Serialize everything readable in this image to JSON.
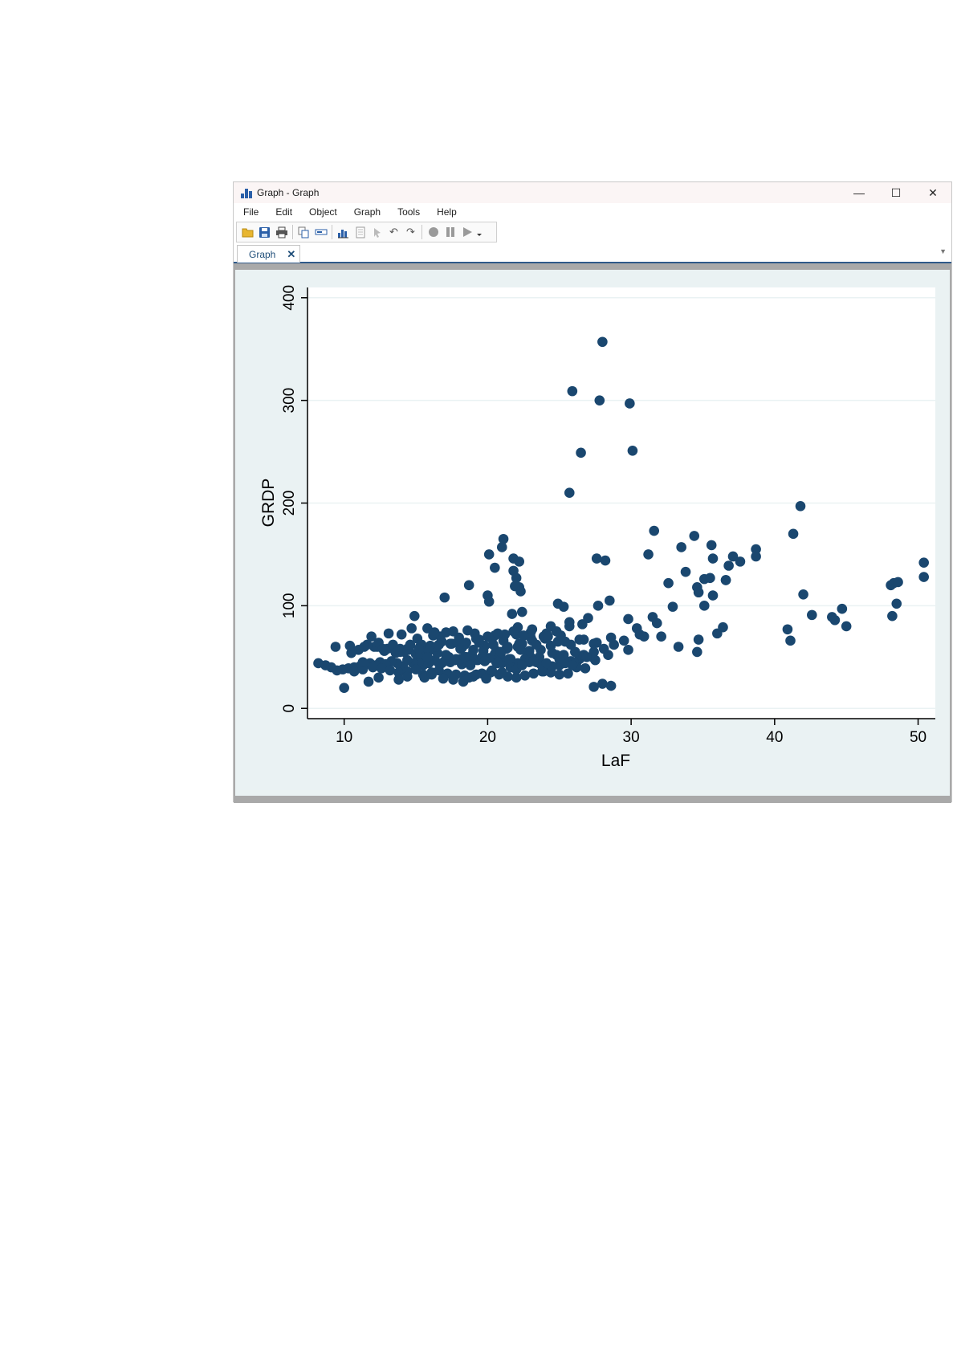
{
  "window": {
    "title": "Graph - Graph",
    "controls": {
      "minimize": "—",
      "maximize": "☐",
      "close": "✕"
    }
  },
  "menu": [
    "File",
    "Edit",
    "Object",
    "Graph",
    "Tools",
    "Help"
  ],
  "toolbar": {
    "icons": [
      "open-icon",
      "save-icon",
      "print-icon",
      "copy-icon",
      "rename-icon",
      "graph-editor-icon",
      "browse-icon",
      "pointer-icon",
      "undo-icon",
      "redo-icon",
      "record-icon",
      "pause-icon",
      "play-icon",
      "dropdown-icon"
    ]
  },
  "tab": {
    "label": "Graph",
    "close": "✕"
  },
  "colors": {
    "marker": "#1a476f",
    "plot_bg": "#ffffff",
    "graph_bg": "#eaf2f3",
    "grid": "#eaf2f3"
  },
  "chart_data": {
    "type": "scatter",
    "xlabel": "LaF",
    "ylabel": "GRDP",
    "xlim": [
      7.5,
      51.2
    ],
    "ylim": [
      -10,
      410
    ],
    "xticks": [
      10,
      20,
      30,
      40,
      50
    ],
    "yticks": [
      0,
      100,
      200,
      300,
      400
    ],
    "grid": "horizontal",
    "marker_color": "#1a476f",
    "x": [
      28.0,
      25.9,
      27.8,
      29.9,
      30.1,
      26.5,
      25.7,
      41.8,
      41.3,
      21.1,
      21.0,
      20.1,
      21.8,
      22.2,
      20.5,
      21.8,
      22.0,
      22.2,
      21.9,
      22.3,
      20.0,
      18.7,
      17.0,
      20.1,
      24.9,
      25.3,
      22.4,
      21.7,
      31.6,
      31.2,
      33.5,
      34.4,
      35.6,
      35.7,
      35.1,
      34.6,
      34.7,
      35.1,
      35.7,
      36.6,
      36.8,
      37.1,
      37.6,
      38.7,
      38.7,
      33.8,
      32.6,
      32.9,
      31.5,
      31.8,
      36.0,
      36.4,
      35.5,
      34.7,
      33.3,
      34.6,
      36.6,
      32.1,
      27.6,
      28.2,
      28.5,
      27.7,
      29.8,
      30.4,
      30.6,
      30.9,
      29.8,
      28.8,
      28.4,
      27.5,
      27.3,
      26.4,
      26.2,
      25.8,
      25.0,
      24.4,
      23.9,
      23.4,
      23.0,
      22.6,
      22.8,
      22.1,
      21.6,
      21.3,
      21.0,
      20.6,
      20.1,
      19.7,
      19.3,
      18.9,
      18.5,
      18.2,
      17.8,
      17.4,
      17.0,
      16.6,
      16.3,
      15.9,
      15.5,
      15.2,
      14.8,
      14.4,
      14.1,
      13.7,
      13.3,
      12.9,
      12.5,
      12.2,
      11.8,
      11.5,
      11.1,
      10.7,
      10.3,
      9.9,
      9.5,
      9.1,
      8.7,
      8.2,
      10.7,
      11.3,
      12.0,
      12.6,
      13.2,
      13.8,
      14.4,
      15.0,
      15.5,
      16.1,
      16.6,
      17.2,
      17.8,
      18.4,
      19.0,
      19.6,
      20.2,
      20.8,
      21.4,
      22.0,
      22.6,
      23.2,
      23.8,
      24.4,
      25.0,
      25.6,
      26.2,
      26.8,
      27.4,
      28.0,
      28.6,
      10.0,
      11.7,
      12.4,
      13.8,
      14.4,
      15.6,
      16.1,
      16.9,
      17.6,
      18.3,
      18.7,
      19.2,
      19.9,
      20.3,
      21.0,
      21.6,
      22.0,
      22.9,
      23.7,
      24.5,
      25.4,
      26.0,
      26.7,
      27.4,
      28.1,
      12.1,
      12.8,
      13.5,
      14.2,
      15.0,
      15.7,
      16.5,
      17.3,
      18.1,
      18.9,
      19.7,
      20.5,
      21.3,
      22.1,
      22.9,
      23.7,
      24.5,
      25.3,
      26.1,
      26.9,
      11.0,
      11.6,
      12.3,
      13.0,
      13.7,
      14.5,
      15.3,
      16.0,
      16.8,
      17.5,
      18.2,
      19.0,
      19.8,
      20.6,
      21.4,
      22.2,
      23.1,
      24.0,
      24.9,
      25.8,
      26.7,
      27.6,
      28.6,
      29.5,
      10.5,
      11.9,
      13.1,
      14.0,
      15.1,
      16.2,
      17.1,
      18.0,
      19.1,
      20.0,
      21.1,
      22.0,
      23.0,
      24.1,
      25.1,
      9.4,
      10.4,
      11.4,
      12.4,
      13.4,
      14.4,
      15.4,
      16.4,
      17.4,
      18.4,
      19.4,
      20.4,
      21.4,
      22.4,
      23.4,
      24.4,
      25.4,
      26.4,
      27.4,
      14.9,
      15.8,
      16.7,
      17.6,
      18.5,
      19.4,
      20.3,
      21.2,
      22.1,
      23.0,
      23.9,
      24.8,
      25.7,
      26.6,
      12.7,
      13.9,
      15.3,
      16.6,
      17.9,
      19.2,
      20.5,
      21.8,
      23.1,
      24.4,
      25.7,
      27.0,
      11.3,
      13.6,
      15.9,
      18.1,
      19.6,
      20.9,
      14.7,
      16.3,
      18.6,
      20.7,
      22.5,
      24.2,
      40.9,
      41.1,
      42.0,
      42.6,
      44.0,
      44.2,
      44.7,
      45.0,
      48.1,
      48.3,
      48.6,
      48.2,
      48.5,
      50.4,
      50.4,
      15.2,
      13.9,
      14.6,
      15.8,
      17.1,
      18.4,
      19.7,
      20.9,
      22.3,
      23.6,
      24.8,
      26.1,
      16.8,
      17.7,
      18.8,
      19.8,
      20.7,
      21.5,
      22.4,
      23.2,
      24.1,
      25.0,
      25.9
    ],
    "y": [
      357,
      309,
      300,
      297,
      251,
      249,
      210,
      197,
      170,
      165,
      157,
      150,
      146,
      143,
      137,
      134,
      127,
      118,
      119,
      114,
      110,
      120,
      108,
      104,
      102,
      99,
      94,
      92,
      173,
      150,
      157,
      168,
      159,
      146,
      126,
      118,
      113,
      100,
      110,
      125,
      139,
      148,
      143,
      155,
      148,
      133,
      122,
      99,
      89,
      83,
      73,
      79,
      127,
      67,
      60,
      55,
      125,
      70,
      146,
      144,
      105,
      100,
      87,
      78,
      72,
      70,
      57,
      62,
      52,
      47,
      50,
      48,
      45,
      46,
      42,
      38,
      36,
      45,
      50,
      48,
      53,
      44,
      48,
      46,
      44,
      45,
      49,
      50,
      47,
      51,
      50,
      43,
      48,
      45,
      46,
      44,
      47,
      44,
      42,
      45,
      44,
      47,
      41,
      44,
      46,
      43,
      45,
      42,
      44,
      43,
      41,
      40,
      39,
      38,
      37,
      40,
      42,
      44,
      36,
      38,
      40,
      39,
      37,
      35,
      36,
      38,
      33,
      35,
      37,
      34,
      33,
      32,
      31,
      34,
      35,
      33,
      31,
      30,
      32,
      34,
      36,
      35,
      33,
      34,
      40,
      39,
      21,
      24,
      22,
      20,
      26,
      30,
      28,
      31,
      30,
      33,
      29,
      28,
      26,
      30,
      33,
      29,
      37,
      35,
      40,
      38,
      45,
      43,
      41,
      44,
      45,
      52,
      55,
      58,
      60,
      56,
      57,
      55,
      53,
      51,
      54,
      50,
      48,
      52,
      56,
      53,
      58,
      60,
      56,
      57,
      54,
      52,
      55,
      50,
      57,
      62,
      60,
      58,
      55,
      57,
      53,
      61,
      65,
      63,
      59,
      57,
      61,
      56,
      59,
      63,
      66,
      68,
      65,
      62,
      67,
      64,
      69,
      66,
      54,
      70,
      73,
      72,
      68,
      71,
      74,
      69,
      73,
      70,
      66,
      72,
      69,
      73,
      71,
      60,
      61,
      60,
      64,
      62,
      58,
      62,
      60,
      63,
      62,
      64,
      62,
      60,
      63,
      62,
      61,
      65,
      67,
      63,
      90,
      78,
      70,
      75,
      64,
      67,
      68,
      72,
      79,
      74,
      70,
      75,
      80,
      82,
      58,
      58,
      60,
      62,
      64,
      68,
      71,
      75,
      77,
      80,
      84,
      88,
      45,
      54,
      56,
      58,
      50,
      53,
      78,
      74,
      76,
      73,
      71,
      70,
      77,
      66,
      111,
      91,
      89,
      86,
      97,
      80,
      120,
      122,
      123,
      90,
      102,
      142,
      128,
      58,
      55,
      62,
      50,
      52,
      50,
      48,
      55,
      57,
      50,
      52,
      55,
      44,
      47,
      42,
      46,
      44,
      48,
      42,
      46,
      44,
      48,
      42
    ]
  }
}
